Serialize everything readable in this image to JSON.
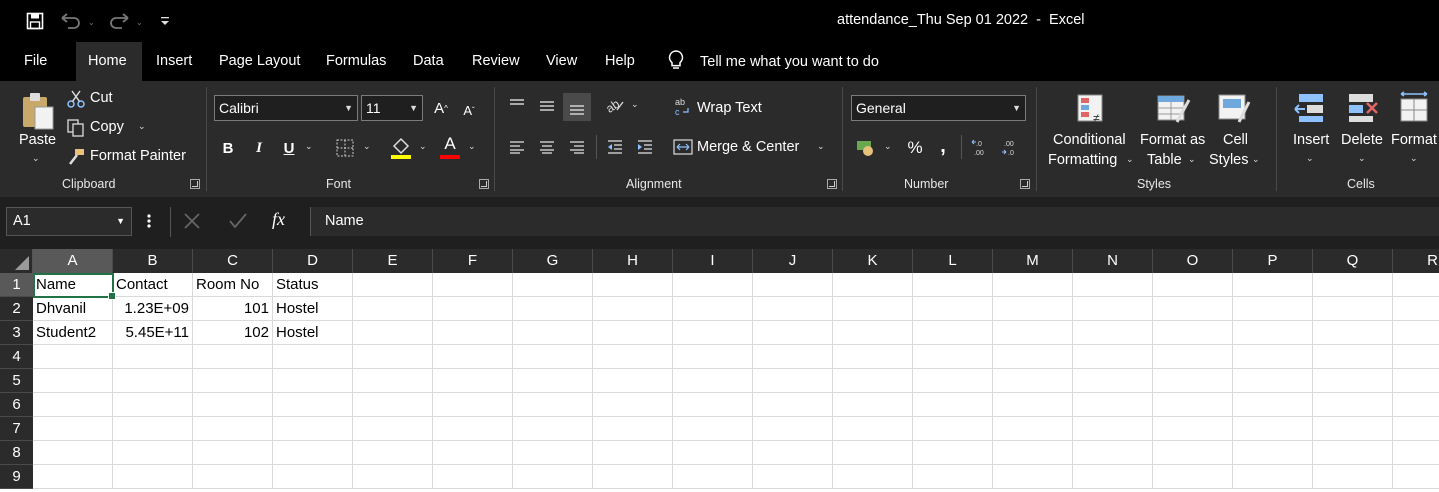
{
  "window": {
    "title": "attendance_Thu Sep 01 2022  -  Excel"
  },
  "quick_access": {
    "save_icon": "save-icon",
    "undo_icon": "undo-icon",
    "redo_icon": "redo-icon",
    "customize_icon": "customize-qat-icon"
  },
  "tabs": [
    "File",
    "Home",
    "Insert",
    "Page Layout",
    "Formulas",
    "Data",
    "Review",
    "View",
    "Help"
  ],
  "active_tab": "Home",
  "tell_me": "Tell me what you want to do",
  "ribbon": {
    "clipboard": {
      "label": "Clipboard",
      "paste": "Paste",
      "cut": "Cut",
      "copy": "Copy",
      "format_painter": "Format Painter"
    },
    "font": {
      "label": "Font",
      "family": "Calibri",
      "size": "11",
      "bold": "B",
      "italic": "I",
      "underline": "U",
      "font_color_glyph": "A",
      "grow": "A",
      "shrink": "A",
      "fill_color": "#ffff00",
      "font_color": "#ff0000"
    },
    "alignment": {
      "label": "Alignment",
      "wrap_text": "Wrap Text",
      "merge_center": "Merge & Center"
    },
    "number": {
      "label": "Number",
      "format": "General",
      "percent": "%",
      "comma": ","
    },
    "styles": {
      "label": "Styles",
      "conditional_1": "Conditional",
      "conditional_2": "Formatting",
      "format_table_1": "Format as",
      "format_table_2": "Table",
      "cell_styles_1": "Cell",
      "cell_styles_2": "Styles"
    },
    "cells": {
      "label": "Cells",
      "insert": "Insert",
      "delete": "Delete",
      "format": "Format"
    }
  },
  "formula_bar": {
    "name_box": "A1",
    "fx": "fx",
    "content": "Name"
  },
  "sheet": {
    "columns": [
      "A",
      "B",
      "C",
      "D",
      "E",
      "F",
      "G",
      "H",
      "I",
      "J",
      "K",
      "L",
      "M",
      "N",
      "O",
      "P",
      "Q",
      "R"
    ],
    "rows": [
      "1",
      "2",
      "3",
      "4",
      "5",
      "6",
      "7",
      "8",
      "9"
    ],
    "cells": {
      "A1": "Name",
      "B1": "Contact",
      "C1": "Room No",
      "D1": "Status",
      "A2": "Dhvanil",
      "B2": "1.23E+09",
      "C2": "101",
      "D2": "Hostel",
      "A3": "Student2",
      "B3": "5.45E+11",
      "C3": "102",
      "D3": "Hostel"
    },
    "selected_cell": "A1"
  }
}
